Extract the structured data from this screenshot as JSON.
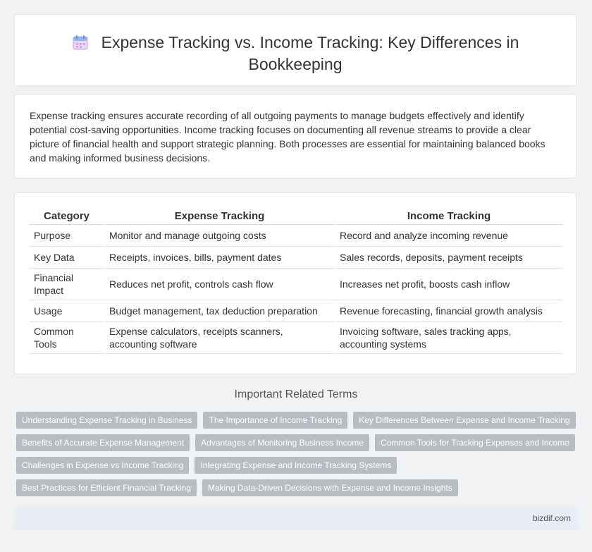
{
  "header": {
    "title": "Expense Tracking vs. Income Tracking: Key Differences in Bookkeeping",
    "icon": "calendar-icon"
  },
  "intro": {
    "text": "Expense tracking ensures accurate recording of all outgoing payments to manage budgets effectively and identify potential cost-saving opportunities. Income tracking focuses on documenting all revenue streams to provide a clear picture of financial health and support strategic planning. Both processes are essential for maintaining balanced books and making informed business decisions."
  },
  "table": {
    "headers": [
      "Category",
      "Expense Tracking",
      "Income Tracking"
    ],
    "rows": [
      [
        "Purpose",
        "Monitor and manage outgoing costs",
        "Record and analyze incoming revenue"
      ],
      [
        "Key Data",
        "Receipts, invoices, bills, payment dates",
        "Sales records, deposits, payment receipts"
      ],
      [
        "Financial Impact",
        "Reduces net profit, controls cash flow",
        "Increases net profit, boosts cash inflow"
      ],
      [
        "Usage",
        "Budget management, tax deduction preparation",
        "Revenue forecasting, financial growth analysis"
      ],
      [
        "Common Tools",
        "Expense calculators, receipts scanners, accounting software",
        "Invoicing software, sales tracking apps, accounting systems"
      ]
    ]
  },
  "related": {
    "title": "Important Related Terms",
    "tags": [
      "Understanding Expense Tracking in Business",
      "The Importance of Income Tracking",
      "Key Differences Between Expense and Income Tracking",
      "Benefits of Accurate Expense Management",
      "Advantages of Monitoring Business Income",
      "Common Tools for Tracking Expenses and Income",
      "Challenges in Expense vs Income Tracking",
      "Integrating Expense and Income Tracking Systems",
      "Best Practices for Efficient Financial Tracking",
      "Making Data-Driven Decisions with Expense and Income Insights"
    ]
  },
  "footer": {
    "site": "bizdif.com"
  },
  "colors": {
    "tag_bg": "#b8bcc3",
    "footer_bg": "#e8ecf5",
    "page_bg": "#f1f2f4"
  }
}
